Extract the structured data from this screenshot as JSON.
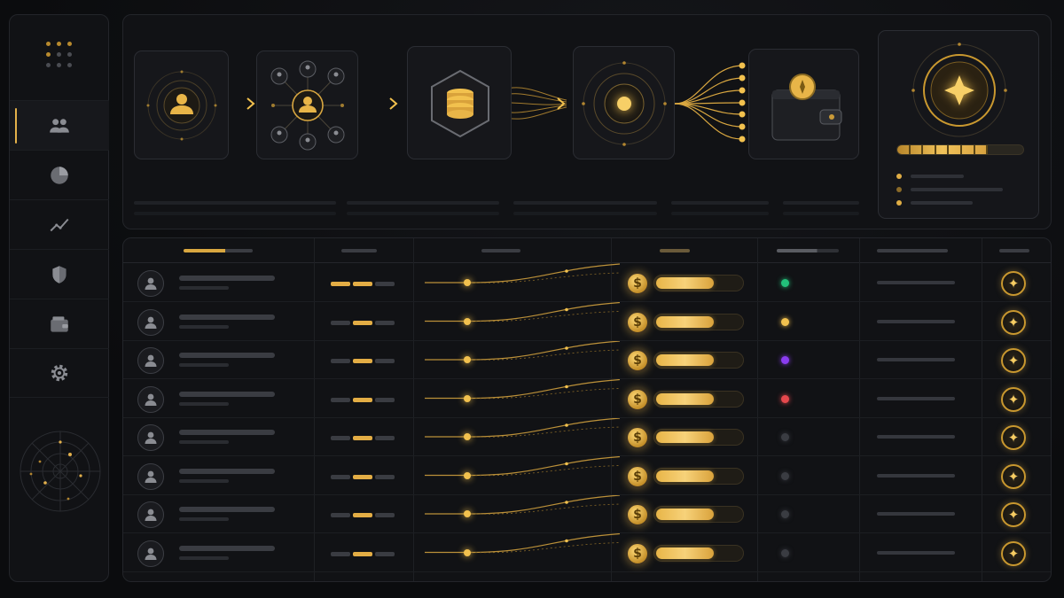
{
  "sidebar": {
    "items": [
      {
        "icon": "users-icon",
        "active": true
      },
      {
        "icon": "pie-chart-icon",
        "active": false
      },
      {
        "icon": "trend-line-icon",
        "active": false
      },
      {
        "icon": "shield-icon",
        "active": false
      },
      {
        "icon": "wallet-icon",
        "active": false
      },
      {
        "icon": "gear-icon",
        "active": false
      }
    ]
  },
  "flow": {
    "stages": [
      "user-node",
      "network-node",
      "database-coins-node",
      "core-orb-node",
      "wallet-node"
    ]
  },
  "summary": {
    "progress": 0.72,
    "accent": "#f2c14e"
  },
  "table": {
    "rows": [
      {
        "coin": "$",
        "bar": 0.82,
        "status_color": "#22c07a",
        "star": "✦"
      },
      {
        "coin": "$",
        "bar": 0.82,
        "status_color": "#f2c14e",
        "star": "✦"
      },
      {
        "coin": "$",
        "bar": 0.82,
        "status_color": "#8a3cf0",
        "star": "✦"
      },
      {
        "coin": "$",
        "bar": 0.82,
        "status_color": "#e5484d",
        "star": "✦"
      },
      {
        "coin": "$",
        "bar": 0.82,
        "status_color": "#3a3c42",
        "star": "✦"
      },
      {
        "coin": "$",
        "bar": 0.82,
        "status_color": "#3a3c42",
        "star": "✦"
      },
      {
        "coin": "$",
        "bar": 0.82,
        "status_color": "#3a3c42",
        "star": "✦"
      },
      {
        "coin": "$",
        "bar": 0.82,
        "status_color": "#3a3c42",
        "star": "✦"
      }
    ]
  },
  "colors": {
    "accent": "#f2c14e",
    "bg": "#0b0c0e",
    "panel": "#111215"
  }
}
